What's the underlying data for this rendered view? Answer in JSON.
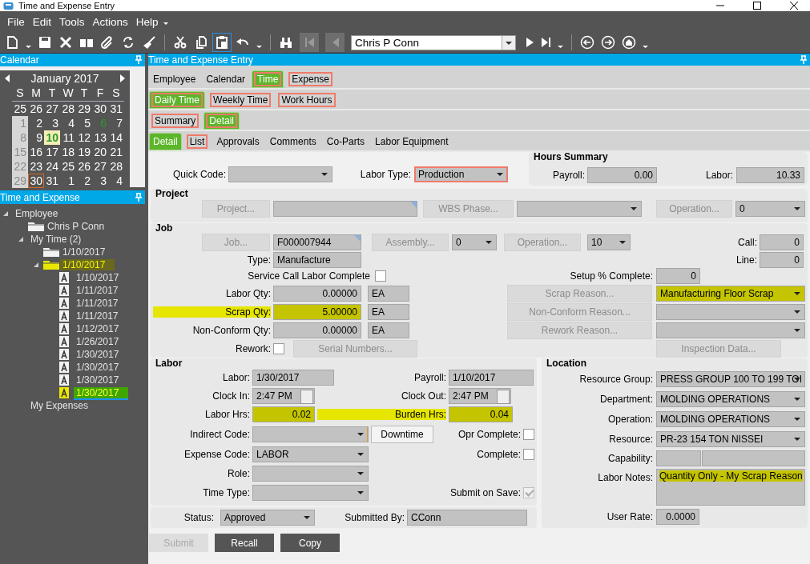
{
  "window": {
    "title": "Time and Expense Entry"
  },
  "menu": [
    {
      "label": "File"
    },
    {
      "label": "Edit"
    },
    {
      "label": "Tools"
    },
    {
      "label": "Actions"
    },
    {
      "label": "Help"
    }
  ],
  "toolbar": {
    "employee": "Chris P Conn"
  },
  "calendar": {
    "title": "Calendar",
    "month": "January 2017",
    "weekdays": [
      "S",
      "M",
      "T",
      "W",
      "T",
      "F",
      "S"
    ],
    "weeks": [
      [
        {
          "day": "25",
          "kind": "normal",
          "selected": false
        },
        {
          "day": "26",
          "kind": "normal",
          "selected": false
        },
        {
          "day": "27",
          "kind": "normal",
          "selected": false
        },
        {
          "day": "28",
          "kind": "normal",
          "selected": false
        },
        {
          "day": "29",
          "kind": "normal",
          "selected": false
        },
        {
          "day": "30",
          "kind": "normal",
          "selected": false
        },
        {
          "day": "31",
          "kind": "normal",
          "selected": false
        }
      ],
      [
        {
          "day": "1",
          "kind": "dimmed",
          "selected": false
        },
        {
          "day": "2",
          "kind": "normal",
          "selected": false
        },
        {
          "day": "3",
          "kind": "normal",
          "selected": false
        },
        {
          "day": "4",
          "kind": "normal",
          "selected": false
        },
        {
          "day": "5",
          "kind": "normal",
          "selected": false
        },
        {
          "day": "6",
          "kind": "entry",
          "selected": false
        },
        {
          "day": "7",
          "kind": "normal",
          "selected": false
        }
      ],
      [
        {
          "day": "8",
          "kind": "dimmed",
          "selected": false
        },
        {
          "day": "9",
          "kind": "normal",
          "selected": false
        },
        {
          "day": "10",
          "kind": "entry",
          "selected": true
        },
        {
          "day": "11",
          "kind": "normal",
          "selected": false
        },
        {
          "day": "12",
          "kind": "normal",
          "selected": false
        },
        {
          "day": "13",
          "kind": "normal",
          "selected": false
        },
        {
          "day": "14",
          "kind": "normal",
          "selected": false
        }
      ],
      [
        {
          "day": "15",
          "kind": "dimmed",
          "selected": false
        },
        {
          "day": "16",
          "kind": "normal",
          "selected": false
        },
        {
          "day": "17",
          "kind": "normal",
          "selected": false
        },
        {
          "day": "18",
          "kind": "normal",
          "selected": false
        },
        {
          "day": "19",
          "kind": "normal",
          "selected": false
        },
        {
          "day": "20",
          "kind": "normal",
          "selected": false
        },
        {
          "day": "21",
          "kind": "normal",
          "selected": false
        }
      ],
      [
        {
          "day": "22",
          "kind": "dimmed",
          "selected": false
        },
        {
          "day": "23",
          "kind": "normal",
          "selected": false
        },
        {
          "day": "24",
          "kind": "normal",
          "selected": false
        },
        {
          "day": "25",
          "kind": "normal",
          "selected": false
        },
        {
          "day": "26",
          "kind": "normal",
          "selected": false
        },
        {
          "day": "27",
          "kind": "normal",
          "selected": false
        },
        {
          "day": "28",
          "kind": "normal",
          "selected": false
        }
      ],
      [
        {
          "day": "29",
          "kind": "dimmed",
          "selected": false
        },
        {
          "day": "30",
          "kind": "today",
          "selected": false
        },
        {
          "day": "31",
          "kind": "normal",
          "selected": false
        },
        {
          "day": "1",
          "kind": "normal",
          "selected": false
        },
        {
          "day": "2",
          "kind": "normal",
          "selected": false
        },
        {
          "day": "3",
          "kind": "normal",
          "selected": false
        },
        {
          "day": "4",
          "kind": "normal",
          "selected": false
        }
      ]
    ]
  },
  "tree": {
    "title": "Time and Expense",
    "items": [
      {
        "label": "Employee",
        "kind": "group",
        "expanded": true,
        "highlighted": false,
        "selected": false,
        "children": [
          {
            "label": "Chris P Conn",
            "kind": "folder",
            "highlighted": false,
            "selected": false
          },
          {
            "label": "My Time (2)",
            "kind": "group",
            "expanded": true,
            "highlighted": false,
            "selected": false,
            "children": [
              {
                "label": "1/10/2017",
                "kind": "folder",
                "highlighted": false,
                "selected": false
              },
              {
                "label": "1/10/2017",
                "kind": "folder",
                "expanded": true,
                "highlighted": true,
                "selected": false,
                "children": [
                  {
                    "label": "1/10/2017",
                    "kind": "entry",
                    "highlighted": false,
                    "selected": false
                  },
                  {
                    "label": "1/11/2017",
                    "kind": "entry",
                    "highlighted": false,
                    "selected": false
                  },
                  {
                    "label": "1/11/2017",
                    "kind": "entry",
                    "highlighted": false,
                    "selected": false
                  },
                  {
                    "label": "1/11/2017",
                    "kind": "entry",
                    "highlighted": false,
                    "selected": false
                  },
                  {
                    "label": "1/12/2017",
                    "kind": "entry",
                    "highlighted": false,
                    "selected": false
                  },
                  {
                    "label": "1/26/2017",
                    "kind": "entry",
                    "highlighted": false,
                    "selected": false
                  },
                  {
                    "label": "1/30/2017",
                    "kind": "entry",
                    "highlighted": false,
                    "selected": false
                  },
                  {
                    "label": "1/30/2017",
                    "kind": "entry",
                    "highlighted": false,
                    "selected": false
                  },
                  {
                    "label": "1/30/2017",
                    "kind": "entry",
                    "highlighted": false,
                    "selected": false
                  },
                  {
                    "label": "1/30/2017",
                    "kind": "entry",
                    "highlighted": true,
                    "selected": true
                  }
                ]
              }
            ]
          },
          {
            "label": "My Expenses",
            "kind": "group",
            "highlighted": false,
            "selected": false
          }
        ]
      }
    ]
  },
  "main": {
    "title": "Time and Expense Entry",
    "tab_rows": [
      [
        {
          "label": "Employee",
          "selected": false,
          "outlined": false
        },
        {
          "label": "Calendar",
          "selected": false,
          "outlined": false
        },
        {
          "label": "Time",
          "selected": true,
          "outlined": true
        },
        {
          "label": "Expense",
          "selected": false,
          "outlined": true
        }
      ],
      [
        {
          "label": "Daily Time",
          "selected": true,
          "outlined": true
        },
        {
          "label": "Weekly Time",
          "selected": false,
          "outlined": true
        },
        {
          "label": "Work Hours",
          "selected": false,
          "outlined": true
        }
      ],
      [
        {
          "label": "Summary",
          "selected": false,
          "outlined": true
        },
        {
          "label": "Detail",
          "selected": true,
          "outlined": true
        }
      ],
      [
        {
          "label": "Detail",
          "selected": true,
          "outlined": false
        },
        {
          "label": "List",
          "selected": false,
          "outlined": true
        },
        {
          "label": "Approvals",
          "selected": false,
          "outlined": false
        },
        {
          "label": "Comments",
          "selected": false,
          "outlined": false
        },
        {
          "label": "Co-Parts",
          "selected": false,
          "outlined": false
        },
        {
          "label": "Labor Equipment",
          "selected": false,
          "outlined": false
        }
      ]
    ],
    "quick_code": {
      "label": "Quick Code:"
    },
    "labor_type": {
      "label": "Labor Type:",
      "value": "Production",
      "outlined": true
    },
    "hours_summary": {
      "title": "Hours Summary",
      "payroll": {
        "label": "Payroll:",
        "value": "0.00"
      },
      "labor": {
        "label": "Labor:",
        "value": "10.33"
      }
    },
    "project": {
      "title": "Project",
      "project_button": "Project...",
      "wbs_button": "WBS Phase...",
      "operation_button": "Operation...",
      "operation": {
        "value": "0"
      }
    },
    "job": {
      "title": "Job",
      "job_button": "Job...",
      "job": {
        "value": "F000007944"
      },
      "assembly_button": "Assembly...",
      "assembly": {
        "value": "0"
      },
      "operation_button": "Operation...",
      "operation": {
        "value": "10"
      },
      "call": {
        "label": "Call:",
        "value": "0"
      },
      "line": {
        "label": "Line:",
        "value": "0"
      },
      "type": {
        "label": "Type:",
        "value": "Manufacture"
      },
      "service_call": {
        "label": "Service Call Labor Complete",
        "checked": false
      },
      "setup": {
        "label": "Setup % Complete:",
        "value": "0"
      },
      "qty_rows": [
        {
          "label": "Labor Qty:",
          "value": "0.00000",
          "uom": "EA",
          "highlighted": false
        },
        {
          "label": "Scrap Qty:",
          "value": "5.00000",
          "uom": "EA",
          "highlighted": true
        },
        {
          "label": "Non-Conform Qty:",
          "value": "0.00000",
          "uom": "EA",
          "highlighted": false
        }
      ],
      "reason_rows": [
        {
          "button": "Scrap Reason...",
          "value": "Manufacturing Floor Scrap",
          "highlighted": true
        },
        {
          "button": "Non-Conform Reason...",
          "highlighted": false
        },
        {
          "button": "Rework Reason...",
          "highlighted": false
        }
      ],
      "rework": {
        "label": "Rework:",
        "checked": false
      },
      "serial_button": "Serial Numbers...",
      "inspection_button": "Inspection Data..."
    },
    "labor": {
      "title": "Labor",
      "labor_date": {
        "label": "Labor:",
        "value": "1/30/2017"
      },
      "payroll_date": {
        "label": "Payroll:",
        "value": "1/10/2017"
      },
      "clock_in": {
        "label": "Clock In:",
        "value": "2:47 PM"
      },
      "clock_out": {
        "label": "Clock Out:",
        "value": "2:47 PM"
      },
      "labor_hrs": {
        "label": "Labor Hrs:",
        "value": "0.02",
        "highlighted": true
      },
      "burden_hrs": {
        "label": "Burden Hrs:",
        "value": "0.04",
        "highlighted": true
      },
      "indirect_code": {
        "label": "Indirect Code:"
      },
      "downtime_button": "Downtime",
      "opr_complete": {
        "label": "Opr Complete:",
        "checked": false
      },
      "expense_code": {
        "label": "Expense Code:",
        "value": "LABOR"
      },
      "complete": {
        "label": "Complete:",
        "checked": false
      },
      "role": {
        "label": "Role:"
      },
      "time_type": {
        "label": "Time Type:"
      },
      "submit_on_save": {
        "label": "Submit on Save:",
        "checked": true,
        "disabled": true
      }
    },
    "status": {
      "label": "Status:",
      "value": "Approved"
    },
    "submitted_by": {
      "label": "Submitted By:",
      "value": "CConn"
    },
    "location": {
      "title": "Location",
      "fields": [
        {
          "label": "Resource Group:",
          "value": "PRESS GROUP 100 TO 199 TOI",
          "kind": "combo",
          "highlighted": false
        },
        {
          "label": "Department:",
          "value": "MOLDING OPERATIONS",
          "kind": "combo",
          "highlighted": false
        },
        {
          "label": "Operation:",
          "value": "MOLDING OPERATIONS",
          "kind": "combo",
          "highlighted": false
        },
        {
          "label": "Resource:",
          "value": "PR-23 154 TON NISSEI",
          "kind": "combo",
          "highlighted": false
        },
        {
          "label": "Capability:",
          "kind": "split",
          "highlighted": false
        },
        {
          "label": "Labor Notes:",
          "value": "Quantity Only - My Scrap Reason",
          "kind": "memo",
          "highlighted": true
        },
        {
          "label": "User Rate:",
          "value": "0.0000",
          "kind": "number",
          "highlighted": false
        }
      ]
    },
    "buttons": [
      {
        "label": "Submit",
        "disabled": true
      },
      {
        "label": "Recall",
        "disabled": false
      },
      {
        "label": "Copy",
        "disabled": false
      }
    ]
  }
}
